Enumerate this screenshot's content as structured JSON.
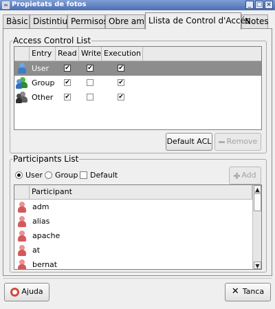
{
  "window": {
    "title": "Propietats de fotos",
    "buttons": [
      "_",
      "□",
      "×"
    ]
  },
  "tabs": [
    {
      "label": "Bàsic"
    },
    {
      "label": "Distintius"
    },
    {
      "label": "Permisos"
    },
    {
      "label": "Obre amb"
    },
    {
      "label": "Llista de Control d'Accés",
      "active": true
    },
    {
      "label": "Notes"
    }
  ],
  "acl": {
    "frame_label": "Access Control List",
    "columns": [
      "Entry",
      "Read",
      "Write",
      "Execution"
    ],
    "rows": [
      {
        "entry": "User",
        "read": true,
        "write": true,
        "execution": true,
        "selected": true,
        "icon": "user-icon"
      },
      {
        "entry": "Group",
        "read": true,
        "write": false,
        "execution": true,
        "selected": false,
        "icon": "group-icon"
      },
      {
        "entry": "Other",
        "read": true,
        "write": false,
        "execution": true,
        "selected": false,
        "icon": "other-icon"
      }
    ],
    "default_acl_label": "Default ACL",
    "remove_label": "Remove"
  },
  "participants": {
    "frame_label": "Participants List",
    "radio_user": "User",
    "radio_group": "Group",
    "selected_radio": "User",
    "default_checkbox_label": "Default",
    "default_checked": false,
    "add_label": "Add",
    "column_header": "Participant",
    "items": [
      "adm",
      "alias",
      "apache",
      "at",
      "bernat"
    ]
  },
  "footer": {
    "help_label": "Ajuda",
    "close_label": "Tanca"
  },
  "colors": {
    "selection": "#8d8d8d",
    "titlebar": "#5a7bbd",
    "user_icon": "#4f8fd6",
    "group_icon_a": "#3a9e3a",
    "group_icon_b": "#2f74c6",
    "other_icon": "#6a6a6a",
    "participant_icon": "#e06a6a"
  }
}
